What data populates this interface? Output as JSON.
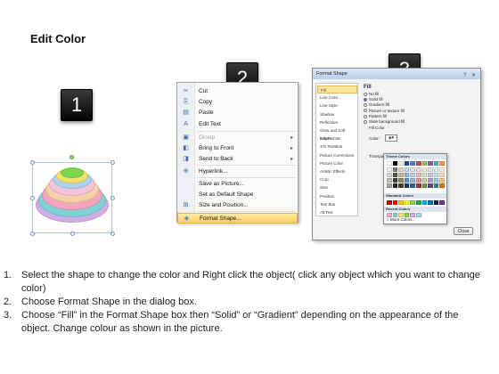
{
  "title": "Edit Color",
  "steps": {
    "one": "1",
    "two": "2",
    "three": "3"
  },
  "shape_colors": [
    "#d2aee6",
    "#7fd3d7",
    "#f4a6be",
    "#f6d0a6",
    "#f3c4d9",
    "#a8d2ef",
    "#f2e06a",
    "#7ed64e"
  ],
  "context_menu": {
    "items": [
      {
        "icon": "cut-icon",
        "label": "Cut"
      },
      {
        "icon": "copy-icon",
        "label": "Copy"
      },
      {
        "icon": "paste-icon",
        "label": "Paste"
      },
      {
        "icon": "edit-text-icon",
        "label": "Edit Text"
      },
      {
        "icon": "group-icon",
        "label": "Group"
      },
      {
        "icon": "bring-to-front-icon",
        "label": "Bring to Front"
      },
      {
        "icon": "send-to-back-icon",
        "label": "Send to Back"
      },
      {
        "icon": "hyperlink-icon",
        "label": "Hyperlink..."
      },
      {
        "icon": "save-as-picture-icon",
        "label": "Save as Picture..."
      },
      {
        "icon": "",
        "label": "Set as Default Shape"
      },
      {
        "icon": "size-position-icon",
        "label": "Size and Position..."
      },
      {
        "icon": "format-shape-icon",
        "label": "Format Shape..."
      }
    ]
  },
  "dialog": {
    "title": "Format Shape",
    "categories": [
      "Fill",
      "Line Color",
      "Line Style",
      "Shadow",
      "Reflection",
      "Glow and Soft Edges",
      "3-D Format",
      "3-D Rotation",
      "Picture Corrections",
      "Picture Color",
      "Artistic Effects",
      "Crop",
      "Size",
      "Position",
      "Text Box",
      "Alt Text"
    ],
    "section_title": "Fill",
    "options": [
      "No fill",
      "Solid fill",
      "Gradient fill",
      "Picture or texture fill",
      "Pattern fill",
      "Slide background fill"
    ],
    "fill_color_label": "Fill Color",
    "color_label": "Color:",
    "transparency_label": "Transpar",
    "palette": {
      "theme_title": "Theme Colors",
      "standard_title": "Standard Colors",
      "recent_title": "Recent Colors",
      "more_colors": "More Colors...",
      "theme_top": [
        "#ffffff",
        "#000000",
        "#eeece1",
        "#1f497d",
        "#4f81bd",
        "#c0504d",
        "#9bbb59",
        "#8064a2",
        "#4bacc6",
        "#f79646"
      ],
      "theme_shades": [
        "#f2f2f2",
        "#7f7f7f",
        "#ddd9c3",
        "#c6d9f0",
        "#dbe5f1",
        "#f2dcdb",
        "#ebf1dd",
        "#e5e0ec",
        "#dbeef3",
        "#fdeada",
        "#d8d8d8",
        "#595959",
        "#c4bd97",
        "#8db3e2",
        "#b8cce4",
        "#e5b9b7",
        "#d7e3bc",
        "#ccc1d9",
        "#b7dde8",
        "#fbd5b5",
        "#bfbfbf",
        "#3f3f3f",
        "#938953",
        "#548dd4",
        "#95b3d7",
        "#d99694",
        "#c3d69b",
        "#b2a2c7",
        "#92cddc",
        "#fac08f",
        "#a5a5a5",
        "#262626",
        "#494429",
        "#17365d",
        "#366092",
        "#953734",
        "#76923c",
        "#5f497a",
        "#31859b",
        "#e36c09"
      ],
      "standard": [
        "#c00000",
        "#ff0000",
        "#ffc000",
        "#ffff00",
        "#92d050",
        "#00b050",
        "#00b0f0",
        "#0070c0",
        "#002060",
        "#7030a0"
      ],
      "recent": [
        "#f4a6be",
        "#7fd3d7",
        "#f2e06a",
        "#7ed64e",
        "#d2aee6",
        "#a8d2ef"
      ]
    },
    "close_label": "Close"
  },
  "instructions": [
    {
      "num": "1.",
      "text": "Select the shape to change the color and Right click the object( click any object which you want to change color)"
    },
    {
      "num": "2.",
      "text": "Choose Format Shape in the dialog box."
    },
    {
      "num": "3.",
      "text": "Choose “Fill” in the Format Shape box then “Solid” or “Gradient” depending on the appearance of the object. Change colour as shown in the picture."
    }
  ]
}
